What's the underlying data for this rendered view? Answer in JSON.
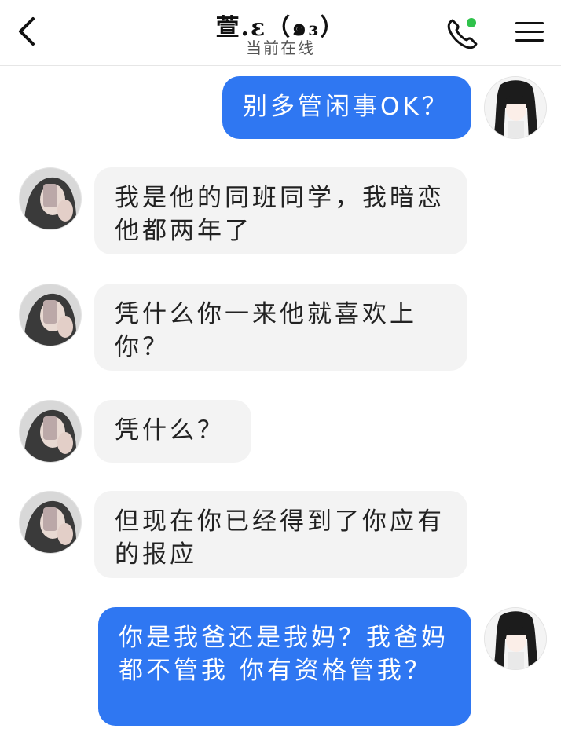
{
  "header": {
    "title": "萱.ε（๑₃）",
    "status": "当前在线",
    "back_icon": "chevron-left-icon",
    "call_icon": "phone-icon",
    "menu_icon": "menu-icon",
    "online_color": "#2fc24b"
  },
  "messages": [
    {
      "direction": "out",
      "text": "别多管闲事OK？"
    },
    {
      "direction": "in",
      "text": "我是他的同班同学，我暗恋他都两年了"
    },
    {
      "direction": "in",
      "text": "凭什么你一来他就喜欢上你？"
    },
    {
      "direction": "in",
      "text": "凭什么？"
    },
    {
      "direction": "in",
      "text": "但现在你已经得到了你应有的报应"
    },
    {
      "direction": "out",
      "text": "你是我爸还是我妈？我爸妈都不管我 你有资格管我？"
    }
  ],
  "colors": {
    "outgoing_bubble": "#2f77f2",
    "incoming_bubble": "#f3f3f3"
  }
}
